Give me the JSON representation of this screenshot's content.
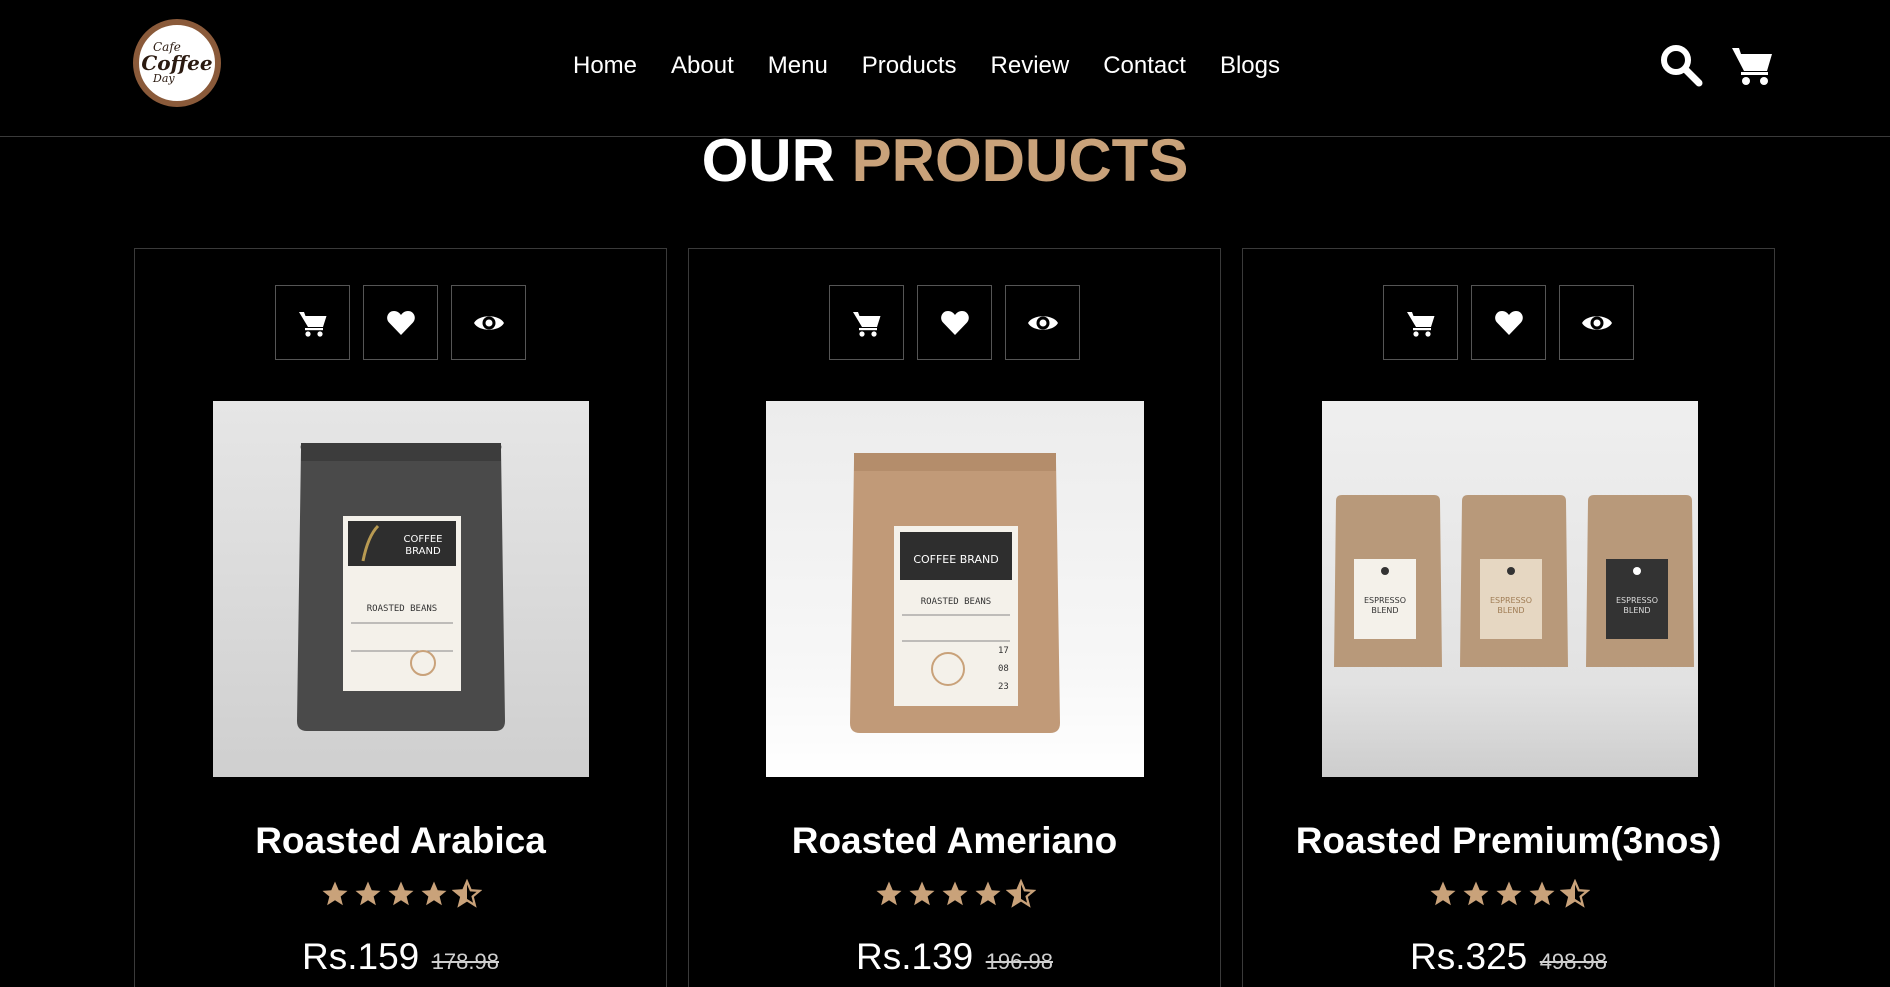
{
  "brand": {
    "logo_line1": "Cafe",
    "logo_line2": "Coffee",
    "logo_line3": "Day",
    "accent_color": "#c9a27a"
  },
  "nav": {
    "items": [
      {
        "label": "Home"
      },
      {
        "label": "About"
      },
      {
        "label": "Menu"
      },
      {
        "label": "Products"
      },
      {
        "label": "Review"
      },
      {
        "label": "Contact"
      },
      {
        "label": "Blogs"
      }
    ]
  },
  "header_icons": [
    "search-icon",
    "cart-icon"
  ],
  "section": {
    "title_main": "OUR",
    "title_accent": "PRODUCTS"
  },
  "products": [
    {
      "name": "Roasted Arabica",
      "price": "Rs.159",
      "old_price": "178.98",
      "rating": 4.5,
      "actions": [
        "cart-icon",
        "heart-icon",
        "eye-icon"
      ]
    },
    {
      "name": "Roasted Ameriano",
      "price": "Rs.139",
      "old_price": "196.98",
      "rating": 4.5,
      "actions": [
        "cart-icon",
        "heart-icon",
        "eye-icon"
      ]
    },
    {
      "name": "Roasted Premium(3nos)",
      "price": "Rs.325",
      "old_price": "498.98",
      "rating": 4.5,
      "actions": [
        "cart-icon",
        "heart-icon",
        "eye-icon"
      ]
    }
  ],
  "colors": {
    "background": "#000000",
    "border": "#3a3a3a",
    "star": "#c9a27a"
  }
}
